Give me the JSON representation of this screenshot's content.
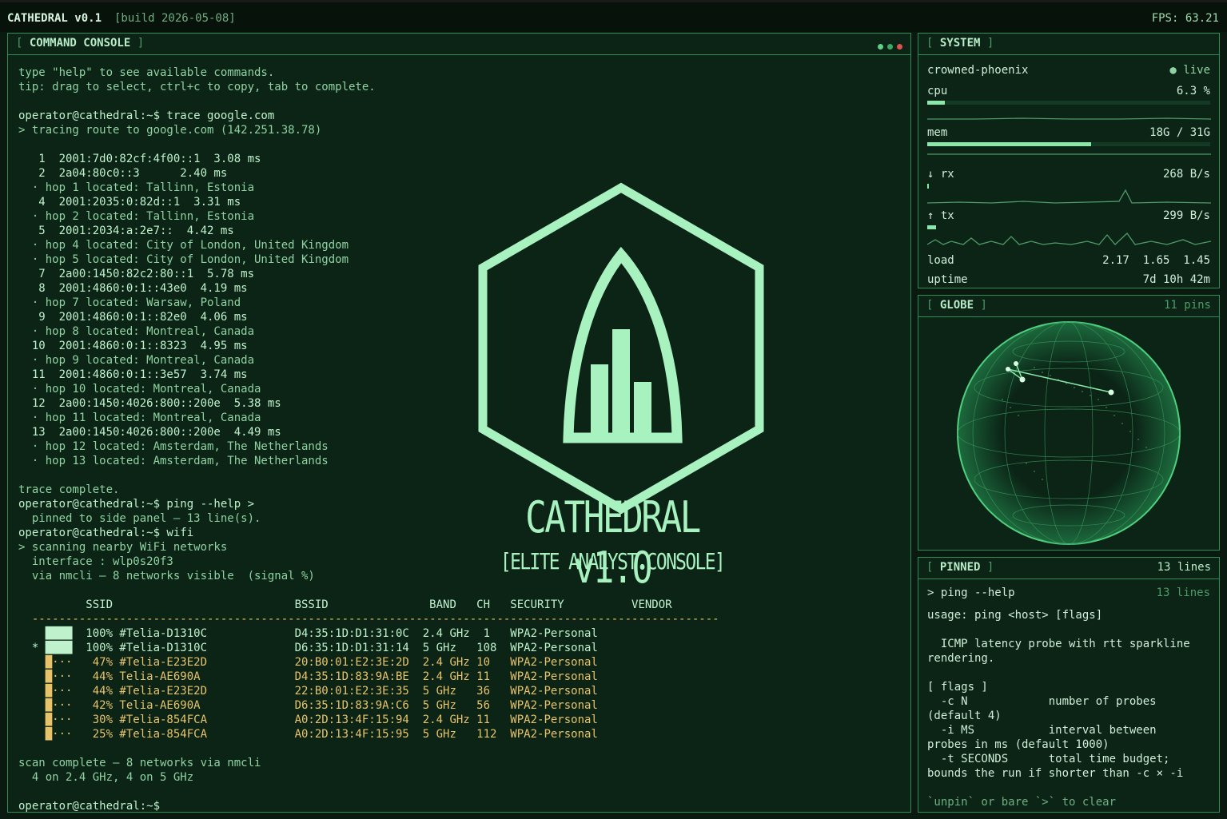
{
  "topbar": {
    "title": "CATHEDRAL v0.1",
    "build": "[build 2026-05-08]",
    "fps": "FPS: 63.21"
  },
  "console": {
    "title": "COMMAND CONSOLE",
    "lines": [
      {
        "t": "type \"help\" to see available commands.",
        "c": "dim"
      },
      {
        "t": "tip: drag to select, ctrl+c to copy, tab to complete.",
        "c": "dim"
      },
      {
        "t": "",
        "c": "dim"
      },
      {
        "t": "operator@cathedral:~$ trace google.com",
        "c": "hdr"
      },
      {
        "t": "> tracing route to google.com (142.251.38.78)",
        "c": "dim"
      },
      {
        "t": "",
        "c": "dim"
      },
      {
        "t": "   1  2001:7d0:82cf:4f00::1  3.08 ms",
        "c": "hdr"
      },
      {
        "t": "   2  2a04:80c0::3      2.40 ms",
        "c": "hdr"
      },
      {
        "t": "  · hop 1 located: Tallinn, Estonia",
        "c": "dim"
      },
      {
        "t": "   4  2001:2035:0:82d::1  3.31 ms",
        "c": "hdr"
      },
      {
        "t": "  · hop 2 located: Tallinn, Estonia",
        "c": "dim"
      },
      {
        "t": "   5  2001:2034:a:2e7::  4.42 ms",
        "c": "hdr"
      },
      {
        "t": "  · hop 4 located: City of London, United Kingdom",
        "c": "dim"
      },
      {
        "t": "  · hop 5 located: City of London, United Kingdom",
        "c": "dim"
      },
      {
        "t": "   7  2a00:1450:82c2:80::1  5.78 ms",
        "c": "hdr"
      },
      {
        "t": "   8  2001:4860:0:1::43e0  4.19 ms",
        "c": "hdr"
      },
      {
        "t": "  · hop 7 located: Warsaw, Poland",
        "c": "dim"
      },
      {
        "t": "   9  2001:4860:0:1::82e0  4.06 ms",
        "c": "hdr"
      },
      {
        "t": "  · hop 8 located: Montreal, Canada",
        "c": "dim"
      },
      {
        "t": "  10  2001:4860:0:1::8323  4.95 ms",
        "c": "hdr"
      },
      {
        "t": "  · hop 9 located: Montreal, Canada",
        "c": "dim"
      },
      {
        "t": "  11  2001:4860:0:1::3e57  3.74 ms",
        "c": "hdr"
      },
      {
        "t": "  · hop 10 located: Montreal, Canada",
        "c": "dim"
      },
      {
        "t": "  12  2a00:1450:4026:800::200e  5.38 ms",
        "c": "hdr"
      },
      {
        "t": "  · hop 11 located: Montreal, Canada",
        "c": "dim"
      },
      {
        "t": "  13  2a00:1450:4026:800::200e  4.49 ms",
        "c": "hdr"
      },
      {
        "t": "  · hop 12 located: Amsterdam, The Netherlands",
        "c": "dim"
      },
      {
        "t": "  · hop 13 located: Amsterdam, The Netherlands",
        "c": "dim"
      },
      {
        "t": "",
        "c": "dim"
      },
      {
        "t": "trace complete.",
        "c": "dim"
      },
      {
        "t": "operator@cathedral:~$ ping --help >",
        "c": "hdr"
      },
      {
        "t": "  pinned to side panel — 13 line(s).",
        "c": "dim"
      },
      {
        "t": "operator@cathedral:~$ wifi",
        "c": "hdr"
      },
      {
        "t": "> scanning nearby WiFi networks",
        "c": "dim"
      },
      {
        "t": "  interface : wlp0s20f3",
        "c": "dim"
      },
      {
        "t": "  via nmcli — 8 networks visible  (signal %)",
        "c": "dim"
      },
      {
        "t": "",
        "c": "dim"
      },
      {
        "t": "          SSID                           BSSID               BAND   CH   SECURITY          VENDOR",
        "c": "hdr"
      },
      {
        "t": "  ------------------------------------------------------------------------------------------------------",
        "c": "amber"
      },
      {
        "t": "    ████  100% #Telia-D1310C             D4:35:1D:D1:31:0C  2.4 GHz  1   WPA2-Personal",
        "c": "hdr"
      },
      {
        "t": "  * ████  100% #Telia-D1310C             D6:35:1D:D1:31:14  5 GHz   108  WPA2-Personal",
        "c": "hdr"
      },
      {
        "t": "    █···   47% #Telia-E23E2D             20:B0:01:E2:3E:2D  2.4 GHz 10   WPA2-Personal",
        "c": "amber"
      },
      {
        "t": "    █···   44% Telia-AE690A              D4:35:1D:83:9A:BE  2.4 GHz 11   WPA2-Personal",
        "c": "amber"
      },
      {
        "t": "    █···   44% #Telia-E23E2D             22:B0:01:E2:3E:35  5 GHz   36   WPA2-Personal",
        "c": "amber"
      },
      {
        "t": "    █···   42% Telia-AE690A              D6:35:1D:83:9A:C6  5 GHz   56   WPA2-Personal",
        "c": "amber"
      },
      {
        "t": "    █···   30% #Telia-854FCA             A0:2D:13:4F:15:94  2.4 GHz 11   WPA2-Personal",
        "c": "amber"
      },
      {
        "t": "    █···   25% #Telia-854FCA             A0:2D:13:4F:15:95  5 GHz   112  WPA2-Personal",
        "c": "amber"
      },
      {
        "t": "",
        "c": "dim"
      },
      {
        "t": "scan complete — 8 networks via nmcli",
        "c": "dim"
      },
      {
        "t": "  4 on 2.4 GHz, 4 on 5 GHz",
        "c": "dim"
      },
      {
        "t": "",
        "c": "dim"
      },
      {
        "t": "operator@cathedral:~$",
        "c": "hdr"
      }
    ]
  },
  "logo": {
    "title": "CATHEDRAL v1.0",
    "subtitle": "[ELITE ANALYST CONSOLE]"
  },
  "system": {
    "title": "SYSTEM",
    "host": "crowned-phoenix",
    "status": "● live",
    "cpu_label": "cpu",
    "cpu_value": "6.3 %",
    "cpu_fraction": 0.063,
    "mem_label": "mem",
    "mem_value": "18G / 31G",
    "mem_fraction": 0.58,
    "rx_label": "↓ rx",
    "rx_value": "268 B/s",
    "tx_label": "↑ tx",
    "tx_value": "299 B/s",
    "load_label": "load",
    "load_values": "2.17  1.65  1.45",
    "uptime_label": "uptime",
    "uptime_value": "7d 10h 42m"
  },
  "globe": {
    "title": "GLOBE",
    "meta": "11 pins"
  },
  "pinned": {
    "title": "PINNED",
    "meta": "13 lines",
    "cmd": "> ping --help",
    "cmd_meta": "13 lines",
    "usage": "usage: ping <host> [flags]",
    "lines": [
      "",
      "  ICMP latency probe with rtt sparkline",
      "rendering.",
      "",
      "[ flags ]",
      "  -c N            number of probes",
      "(default 4)",
      "  -i MS           interval between",
      "probes in ms (default 1000)",
      "  -t SECONDS      total time budget;",
      "bounds the run if shorter than -c × -i",
      "",
      "`unpin` or bare `>` to clear"
    ]
  },
  "colors": {
    "accent": "#8ae9aa",
    "warn": "#e8c36a",
    "border": "#2f8c55",
    "bg": "#0b2416"
  }
}
